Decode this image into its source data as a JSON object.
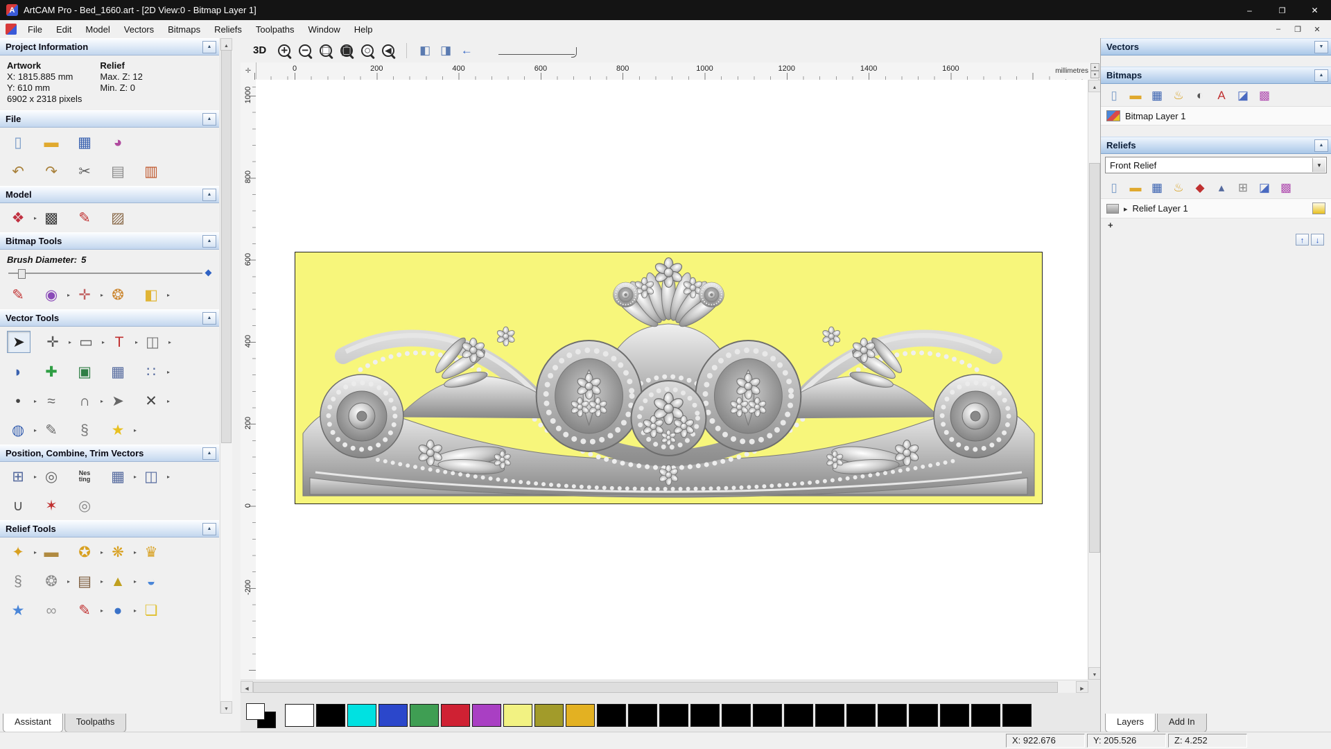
{
  "titlebar": {
    "title": "ArtCAM Pro - Bed_1660.art - [2D View:0 - Bitmap Layer 1]"
  },
  "menubar": {
    "items": [
      "File",
      "Edit",
      "Model",
      "Vectors",
      "Bitmaps",
      "Reliefs",
      "Toolpaths",
      "Window",
      "Help"
    ]
  },
  "left_panel": {
    "project_information": {
      "title": "Project Information",
      "artwork_heading": "Artwork",
      "relief_heading": "Relief",
      "artwork_x": "X: 1815.885 mm",
      "artwork_y": "Y: 610 mm",
      "artwork_pixels": "6902 x 2318 pixels",
      "relief_max": "Max. Z: 12",
      "relief_min": "Min. Z: 0"
    },
    "file": {
      "title": "File",
      "icons_row1": [
        {
          "name": "new-model-icon",
          "glyph": "▯",
          "color": "#7a9cc8"
        },
        {
          "name": "open-model-icon",
          "glyph": "▬",
          "color": "#e0a92e"
        },
        {
          "name": "save-model-icon",
          "glyph": "▦",
          "color": "#3a62b0"
        },
        {
          "name": "model-wizard-icon",
          "glyph": "◕",
          "color": "#b04a9e"
        }
      ],
      "icons_row2": [
        {
          "name": "undo-icon",
          "glyph": "↶",
          "color": "#a8803a"
        },
        {
          "name": "redo-icon",
          "glyph": "↷",
          "color": "#a8803a"
        },
        {
          "name": "cut-icon",
          "glyph": "✂",
          "color": "#606060"
        },
        {
          "name": "copy-icon",
          "glyph": "▤",
          "color": "#8a8a8a"
        },
        {
          "name": "paste-icon",
          "glyph": "▥",
          "color": "#c05a30"
        }
      ]
    },
    "model": {
      "title": "Model",
      "icons": [
        {
          "name": "relief-clipart-icon",
          "glyph": "❖",
          "color": "#c03040",
          "flyout": true
        },
        {
          "name": "greyscale-view-icon",
          "glyph": "▩",
          "color": "#3a3a3a"
        },
        {
          "name": "sculpting-icon",
          "glyph": "✎",
          "color": "#c03030"
        },
        {
          "name": "face-wizard-icon",
          "glyph": "▨",
          "color": "#8a6a4a"
        }
      ]
    },
    "bitmap_tools": {
      "title": "Bitmap Tools",
      "brush_label": "Brush Diameter:",
      "brush_value": "5",
      "icons": [
        {
          "name": "paint-icon",
          "glyph": "✎",
          "color": "#c23535"
        },
        {
          "name": "paint-selected-icon",
          "glyph": "◉",
          "color": "#8a4ab8",
          "flyout": true
        },
        {
          "name": "colour-picker-icon",
          "glyph": "✛",
          "color": "#c06060",
          "flyout": true
        },
        {
          "name": "palette-icon",
          "glyph": "❂",
          "color": "#cc8833"
        },
        {
          "name": "flood-fill-icon",
          "glyph": "◧",
          "color": "#e0b435",
          "flyout": true
        }
      ]
    },
    "vector_tools": {
      "title": "Vector Tools",
      "icons_row1": [
        {
          "name": "select-vectors-icon",
          "glyph": "➤",
          "color": "#222222",
          "active": true
        },
        {
          "name": "transform-vectors-icon",
          "glyph": "✛",
          "color": "#555555",
          "flyout": true
        },
        {
          "name": "create-rectangle-icon",
          "glyph": "▭",
          "color": "#555555",
          "flyout": true
        },
        {
          "name": "create-text-icon",
          "glyph": "T",
          "color": "#c03030",
          "flyout": true
        },
        {
          "name": "mirror-vectors-icon",
          "glyph": "◫",
          "color": "#777777",
          "flyout": true
        }
      ],
      "icons_row2": [
        {
          "name": "offset-vectors-icon",
          "glyph": "◗",
          "color": "#3a62b0"
        },
        {
          "name": "bitmap-to-vector-icon",
          "glyph": "✚",
          "color": "#2f9e44"
        },
        {
          "name": "vector-texture-icon",
          "glyph": "▣",
          "color": "#2f7e44"
        },
        {
          "name": "fillet-grid-icon",
          "glyph": "▦",
          "color": "#556a9e"
        },
        {
          "name": "block-paste-icon",
          "glyph": "∷",
          "color": "#556a9e",
          "flyout": true
        }
      ],
      "icons_row3": [
        {
          "name": "create-polyline-icon",
          "glyph": "•",
          "color": "#444444",
          "flyout": true
        },
        {
          "name": "freehand-draw-icon",
          "glyph": "≈",
          "color": "#666666"
        },
        {
          "name": "create-arc-icon",
          "glyph": "∩",
          "color": "#555555",
          "flyout": true
        },
        {
          "name": "create-polygon-icon",
          "glyph": "➤",
          "color": "#666666"
        },
        {
          "name": "node-editing-icon",
          "glyph": "✕",
          "color": "#444444",
          "flyout": true
        }
      ],
      "icons_row4": [
        {
          "name": "create-circle-icon",
          "glyph": "◍",
          "color": "#3a62b0",
          "flyout": true
        },
        {
          "name": "spline-tool-icon",
          "glyph": "✎",
          "color": "#6a6a6a"
        },
        {
          "name": "wrap-vectors-icon",
          "glyph": "§",
          "color": "#777777"
        },
        {
          "name": "create-star-icon",
          "glyph": "★",
          "color": "#e8c020",
          "flyout": true
        }
      ]
    },
    "position_tools": {
      "title": "Position, Combine, Trim Vectors",
      "icons_row1": [
        {
          "name": "align-vectors-icon",
          "glyph": "⊞",
          "color": "#556a9e",
          "flyout": true
        },
        {
          "name": "circular-array-icon",
          "glyph": "◎",
          "color": "#666666"
        },
        {
          "name": "nesting-icon",
          "glyph": "Nes ting",
          "color": "#333333",
          "small": true
        },
        {
          "name": "block-array-icon",
          "glyph": "▦",
          "color": "#556a9e",
          "flyout": true
        },
        {
          "name": "group-vectors-icon",
          "glyph": "◫",
          "color": "#556a9e",
          "flyout": true
        }
      ],
      "icons_row2": [
        {
          "name": "fit-arc-icon",
          "glyph": "∪",
          "color": "#555555"
        },
        {
          "name": "weld-vectors-icon",
          "glyph": "✶",
          "color": "#c03030"
        },
        {
          "name": "trim-rings-icon",
          "glyph": "◎",
          "color": "#888888"
        }
      ]
    },
    "relief_tools": {
      "title": "Relief Tools",
      "icons_row1": [
        {
          "name": "shape-editor-icon",
          "glyph": "✦",
          "color": "#d8a020",
          "flyout": true
        },
        {
          "name": "smooth-relief-icon",
          "glyph": "▬",
          "color": "#b08a40"
        },
        {
          "name": "sculpting-tools-icon",
          "glyph": "✪",
          "color": "#d8a020",
          "flyout": true
        },
        {
          "name": "texture-relief-icon",
          "glyph": "❋",
          "color": "#d8a020",
          "flyout": true
        },
        {
          "name": "relief-wizard-icon",
          "glyph": "♛",
          "color": "#d8a020"
        }
      ],
      "icons_row2": [
        {
          "name": "swept-profile-icon",
          "glyph": "§",
          "color": "#888888"
        },
        {
          "name": "weave-wizard-icon",
          "glyph": "❂",
          "color": "#8a8a8a",
          "flyout": true
        },
        {
          "name": "relief-library-icon",
          "glyph": "▤",
          "color": "#7a5a3a",
          "flyout": true
        },
        {
          "name": "extrude-icon",
          "glyph": "▲",
          "color": "#c0a020",
          "flyout": true
        },
        {
          "name": "dome-icon",
          "glyph": "◒",
          "color": "#4a86d8"
        }
      ],
      "icons_row3": [
        {
          "name": "star-relief-icon",
          "glyph": "★",
          "color": "#4a86d8"
        },
        {
          "name": "weave-relief-icon",
          "glyph": "∞",
          "color": "#999999"
        },
        {
          "name": "smudge-relief-icon",
          "glyph": "✎",
          "color": "#c03030",
          "flyout": true
        },
        {
          "name": "texture-sphere-icon",
          "glyph": "●",
          "color": "#3a72c8",
          "flyout": true
        },
        {
          "name": "offset-relief-icon",
          "glyph": "❏",
          "color": "#e0c030"
        }
      ]
    },
    "tabs": [
      {
        "label": "Assistant",
        "active": true
      },
      {
        "label": "Toolpaths",
        "active": false
      }
    ]
  },
  "toolbar": {
    "view3d_label": "3D",
    "zoom_icons": [
      {
        "name": "zoom-in-icon",
        "glyph": "+",
        "mag": true
      },
      {
        "name": "zoom-out-icon",
        "glyph": "−",
        "mag": true
      },
      {
        "name": "zoom-window-icon",
        "glyph": "□",
        "mag": true
      },
      {
        "name": "zoom-fit-icon",
        "glyph": "▣",
        "mag": true
      },
      {
        "name": "zoom-objects-icon",
        "glyph": "○",
        "mag": true
      },
      {
        "name": "zoom-previous-icon",
        "glyph": "◂",
        "mag": true
      }
    ],
    "nav_icons": [
      {
        "name": "pan-view-icon",
        "glyph": "◧",
        "color": "#5a7ab0"
      },
      {
        "name": "redraw-view-icon",
        "glyph": "◨",
        "color": "#5a7ab0"
      },
      {
        "name": "previous-view-icon",
        "glyph": "←",
        "color": "#2f62c4"
      }
    ]
  },
  "rulers": {
    "horizontal": [
      "0",
      "200",
      "400",
      "600",
      "800",
      "1000",
      "1200",
      "1400",
      "1600"
    ],
    "vertical": [
      "1000",
      "800",
      "600",
      "400",
      "200",
      "0",
      "-200"
    ],
    "units": "millimetres"
  },
  "right_panel": {
    "vectors": {
      "title": "Vectors"
    },
    "bitmaps": {
      "title": "Bitmaps",
      "layer": "Bitmap Layer 1",
      "icons": [
        {
          "name": "new-bitmap-icon",
          "glyph": "▯",
          "color": "#7a9cc8"
        },
        {
          "name": "open-bitmap-icon",
          "glyph": "▬",
          "color": "#e0a92e"
        },
        {
          "name": "save-bitmap-icon",
          "glyph": "▦",
          "color": "#3a62b0"
        },
        {
          "name": "bitmap-wizard-icon",
          "glyph": "♨",
          "color": "#d8a020"
        },
        {
          "name": "contrast-icon",
          "glyph": "◐",
          "color": "#555555"
        },
        {
          "name": "compare-ab-icon",
          "glyph": "A",
          "color": "#c03030"
        },
        {
          "name": "clear-bitmap-icon",
          "glyph": "◪",
          "color": "#4a6ac0"
        },
        {
          "name": "reduce-colours-icon",
          "glyph": "▩",
          "color": "#b050b0"
        }
      ]
    },
    "reliefs": {
      "title": "Reliefs",
      "combo_value": "Front Relief",
      "layer": "Relief Layer 1",
      "icons": [
        {
          "name": "new-relief-icon",
          "glyph": "▯",
          "color": "#7a9cc8"
        },
        {
          "name": "open-relief-icon",
          "glyph": "▬",
          "color": "#e0a92e"
        },
        {
          "name": "save-relief-icon",
          "glyph": "▦",
          "color": "#3a62b0"
        },
        {
          "name": "relief-lamp-icon",
          "glyph": "♨",
          "color": "#d8a020"
        },
        {
          "name": "smooth-icon",
          "glyph": "◆",
          "color": "#c03030"
        },
        {
          "name": "scale-relief-icon",
          "glyph": "▴",
          "color": "#556a9e"
        },
        {
          "name": "calculate-icon",
          "glyph": "⊞",
          "color": "#888888"
        },
        {
          "name": "reset-relief-icon",
          "glyph": "◪",
          "color": "#4a6ac0"
        },
        {
          "name": "relief-colours-icon",
          "glyph": "▩",
          "color": "#b050b0"
        }
      ]
    },
    "tabs": [
      {
        "label": "Layers",
        "active": true
      },
      {
        "label": "Add In",
        "active": false
      }
    ]
  },
  "palette": {
    "primary": "#ffffff",
    "secondary": "#000000",
    "swatches": [
      "#ffffff",
      "#000000",
      "#00e1e1",
      "#2b47cb",
      "#3f9e53",
      "#cf2133",
      "#a93fc3",
      "#f2f282",
      "#a29b2a",
      "#e3b122",
      "#000000",
      "#000000",
      "#000000",
      "#000000",
      "#000000",
      "#000000",
      "#000000",
      "#000000",
      "#000000",
      "#000000",
      "#000000",
      "#000000",
      "#000000",
      "#000000"
    ]
  },
  "artwork": {
    "background": "#f7f67b"
  },
  "statusbar": {
    "x": "X: 922.676",
    "y": "Y: 205.526",
    "z": "Z: 4.252"
  }
}
